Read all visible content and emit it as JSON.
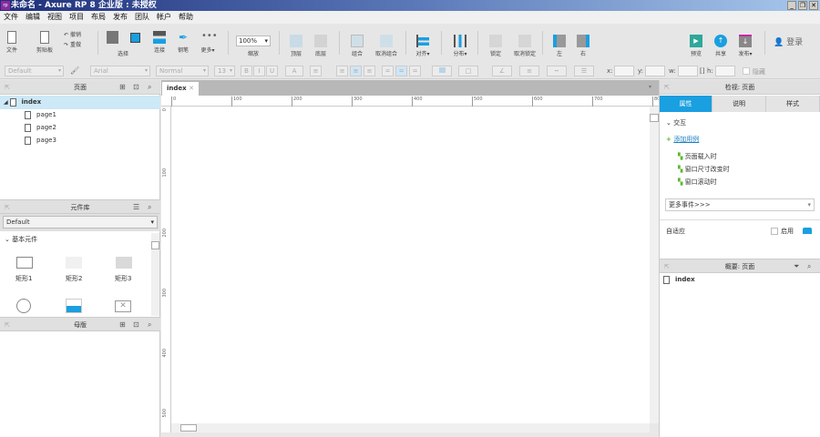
{
  "window": {
    "title": "未命名 - Axure RP 8 企业版 : 未授权",
    "app_icon": "rp",
    "minimize": "_",
    "restore": "❐",
    "close": "✕"
  },
  "menu": [
    "文件",
    "编辑",
    "视图",
    "项目",
    "布局",
    "发布",
    "团队",
    "帐户",
    "帮助"
  ],
  "toolbar": {
    "file": "文件",
    "clipboard": "剪贴板",
    "undo": "撤销",
    "redo": "重做",
    "select": "选择",
    "connect": "连接",
    "pen": "钢笔",
    "more": "更多▾",
    "zoom_value": "100%",
    "zoom": "缩放",
    "top": "顶层",
    "bottom": "底层",
    "group": "组合",
    "ungroup": "取消组合",
    "align": "对齐▾",
    "distribute": "分布▾",
    "lock": "锁定",
    "unlock": "取消锁定",
    "left": "左",
    "right": "右",
    "preview": "预览",
    "share": "共享",
    "publish": "发布▾",
    "login": "登录"
  },
  "format": {
    "style": "Default",
    "font": "Arial",
    "weight": "Normal",
    "size": "13",
    "bold": "B",
    "italic": "I",
    "underline": "U",
    "x": "x:",
    "y": "y:",
    "w": "w:",
    "h": "h:",
    "hidden": "隐藏"
  },
  "pages_panel": {
    "title": "页面",
    "root": "index",
    "pages": [
      "page1",
      "page2",
      "page3"
    ]
  },
  "library_panel": {
    "title": "元件库",
    "library": "Default",
    "section": "基本元件",
    "widgets": [
      "矩形1",
      "矩形2",
      "矩形3"
    ]
  },
  "masters_panel": {
    "title": "母版"
  },
  "canvas": {
    "tab": "index",
    "ruler_x": [
      "0",
      "100",
      "200",
      "300",
      "400",
      "500",
      "600",
      "700",
      "80"
    ],
    "ruler_y": [
      "0",
      "100",
      "200",
      "300",
      "400",
      "500"
    ]
  },
  "inspector": {
    "title": "检视: 页面",
    "tabs": [
      "属性",
      "说明",
      "样式"
    ],
    "section": "交互",
    "add_case": "添加用例",
    "events": [
      "页面载入时",
      "窗口尺寸改变时",
      "窗口滚动时"
    ],
    "more_events": "更多事件>>>",
    "adaptive": "自适应",
    "enable": "启用"
  },
  "outline": {
    "title": "概要: 页面",
    "item": "index"
  },
  "colors": {
    "accent": "#1a9fe0",
    "selection": "#cde8f6",
    "title_start": "#1e2f7a",
    "add_case": "#5cb82e"
  }
}
